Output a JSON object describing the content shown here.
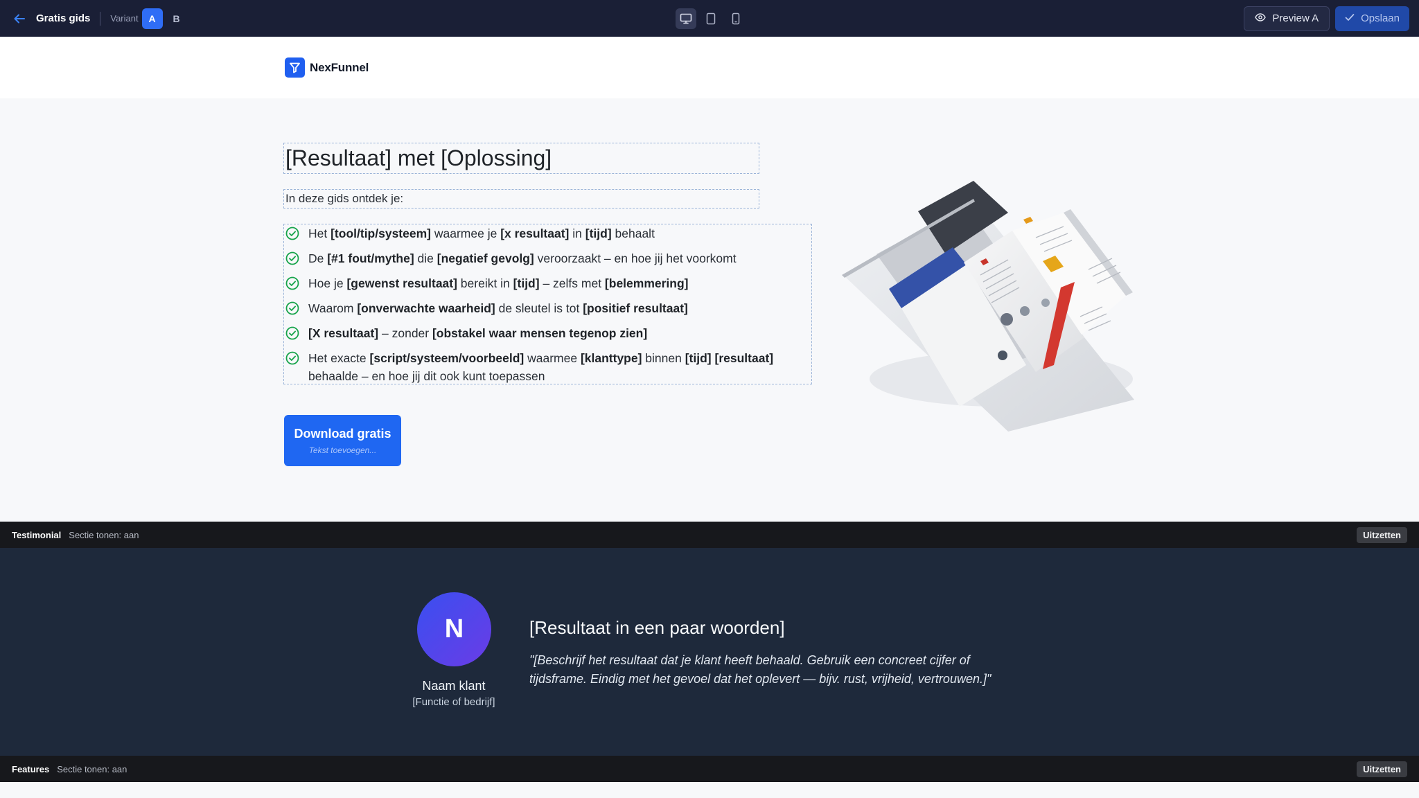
{
  "editor": {
    "page_name": "Gratis gids",
    "variant_label": "Variant",
    "variants": [
      "A",
      "B"
    ],
    "active_variant": "A",
    "devices": [
      "desktop-icon",
      "tablet-icon",
      "mobile-icon"
    ],
    "preview_label": "Preview A",
    "save_label": "Opslaan",
    "colors": {
      "bar": "#1a1f36",
      "accent": "#2f6df6"
    }
  },
  "header": {
    "brand": "NexFunnel"
  },
  "hero": {
    "title": "[Resultaat] met [Oplossing]",
    "intro": "In deze gids ontdek je:",
    "bullets": [
      {
        "html": "Het <b>[tool/tip/systeem]</b> waarmee je <b>[x resultaat]</b> in <b>[tijd]</b> behaalt"
      },
      {
        "html": "De <b>[#1 fout/mythe]</b> die <b>[negatief gevolg]</b> veroorzaakt – en hoe jij het voorkomt"
      },
      {
        "html": "Hoe je <b>[gewenst resultaat]</b> bereikt in <b>[tijd]</b> – zelfs met <b>[belemmering]</b>"
      },
      {
        "html": "Waarom <b>[onverwachte waarheid]</b> de sleutel is tot <b>[positief resultaat]</b>"
      },
      {
        "html": "<b>[X resultaat]</b> – zonder <b>[obstakel waar mensen tegenop zien]</b>"
      },
      {
        "html": "Het exacte <b>[script/systeem/voorbeeld]</b> waarmee <b>[klanttype]</b> binnen <b>[tijd]</b> <b>[resultaat]</b> behaalde – en hoe jij dit ook kunt toepassen"
      }
    ],
    "cta_label": "Download gratis",
    "cta_sub": "Tekst toevoegen..."
  },
  "sections": {
    "testimonial": {
      "title": "Testimonial",
      "status": "Sectie tonen: aan",
      "toggle": "Uitzetten"
    },
    "features": {
      "title": "Features",
      "status": "Sectie tonen: aan",
      "toggle": "Uitzetten"
    }
  },
  "testimonial": {
    "initial": "N",
    "name": "Naam klant",
    "role": "[Functie of bedrijf]",
    "headline": "[Resultaat in een paar woorden]",
    "quote": "\"[Beschrijf het resultaat dat je klant heeft behaald. Gebruik een concreet cijfer of tijdsframe. Eindig met het gevoel dat het oplevert — bijv. rust, vrijheid, vertrouwen.]\""
  }
}
